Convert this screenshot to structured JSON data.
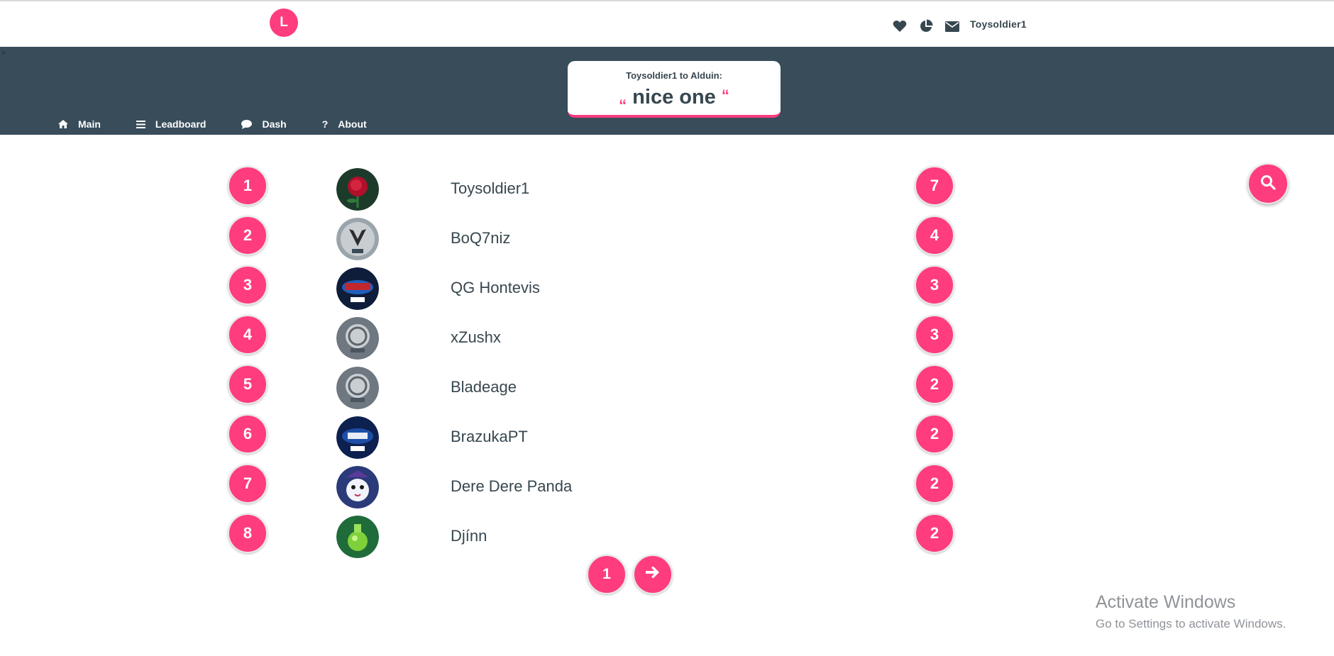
{
  "header": {
    "logo_letter": "L",
    "username": "Toysoldier1",
    "icons": [
      "heart-icon",
      "pie-chart-icon",
      "mail-icon"
    ]
  },
  "banner": {
    "nav": [
      {
        "label": "Main",
        "icon": "home-icon"
      },
      {
        "label": "Leadboard",
        "icon": "list-icon"
      },
      {
        "label": "Dash",
        "icon": "chat-bubble-icon"
      },
      {
        "label": "About",
        "icon": "question-icon"
      }
    ],
    "quote": {
      "heading": "Toysoldier1 to Alduin:",
      "open_mark": "“",
      "text": "nice one",
      "close_mark": "“"
    }
  },
  "leaderboard": {
    "rows": [
      {
        "rank": "1",
        "name": "Toysoldier1",
        "score": "7",
        "avatar": "rose-icon"
      },
      {
        "rank": "2",
        "name": "BoQ7niz",
        "score": "4",
        "avatar": "besiktas-2016-icon"
      },
      {
        "rank": "3",
        "name": "QG Hontevis",
        "score": "3",
        "avatar": "team-2015-icon"
      },
      {
        "rank": "4",
        "name": "xZushx",
        "score": "3",
        "avatar": "tsm-2016-icon"
      },
      {
        "rank": "5",
        "name": "Bladeage",
        "score": "2",
        "avatar": "tsm-2016-icon"
      },
      {
        "rank": "6",
        "name": "BrazukaPT",
        "score": "2",
        "avatar": "paiN-2015-icon"
      },
      {
        "rank": "7",
        "name": "Dere Dere Panda",
        "score": "2",
        "avatar": "poro-icon"
      },
      {
        "rank": "8",
        "name": "Djínn",
        "score": "2",
        "avatar": "potion-icon"
      }
    ]
  },
  "pagination": {
    "current_page": "1",
    "next_icon": "arrow-right-icon"
  },
  "search": {
    "icon": "search-icon"
  },
  "watermark": {
    "title": "Activate Windows",
    "subtitle": "Go to Settings to activate Windows."
  },
  "colors": {
    "accent": "#ff3c7e",
    "banner": "#384c5a",
    "text": "#37474f"
  }
}
